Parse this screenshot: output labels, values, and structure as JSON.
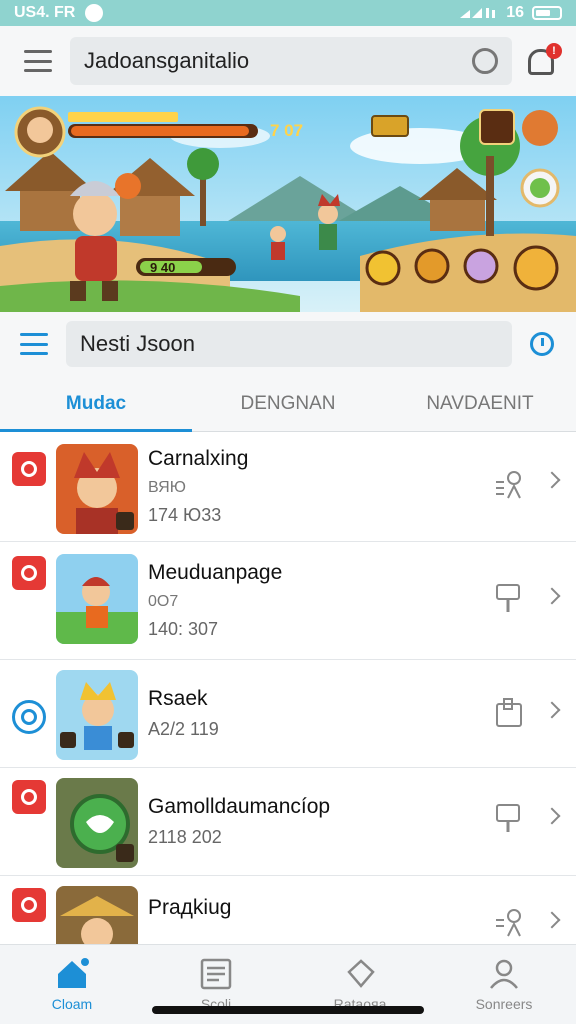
{
  "status_bar": {
    "left_text": "US4. FR",
    "right_text": "16"
  },
  "app_bar": {
    "title": "Jadoansganitalio"
  },
  "banner": {
    "player_level": "7 07",
    "hp_text": "9 40"
  },
  "search2": {
    "value": "Nesti Jsoon"
  },
  "tabs": [
    {
      "label": "Mudac",
      "active": true
    },
    {
      "label": "DENGNAN",
      "active": false
    },
    {
      "label": "NAVDAENIT",
      "active": false
    }
  ],
  "list": [
    {
      "title": "Carnalxing",
      "sub": "ВЯЮ",
      "num": "174 Ю33"
    },
    {
      "title": "Meuduanpage",
      "sub": "0О7",
      "num": "140: 307"
    },
    {
      "title": "Rsaek",
      "sub": "",
      "num": "A2/2 119"
    },
    {
      "title": "Gamolldaumancíop",
      "sub": "",
      "num": "2118 202"
    },
    {
      "title": "Praдkiug",
      "sub": "",
      "num": ""
    }
  ],
  "bottom_nav": [
    {
      "label": "Cloam",
      "active": true
    },
    {
      "label": "Scoli",
      "active": false
    },
    {
      "label": "Rataoяa",
      "active": false
    },
    {
      "label": "Sonreers",
      "active": false
    }
  ],
  "colors": {
    "accent": "#1d8fd6",
    "badge_red": "#e53935",
    "status_bar": "#8fd3cf"
  }
}
